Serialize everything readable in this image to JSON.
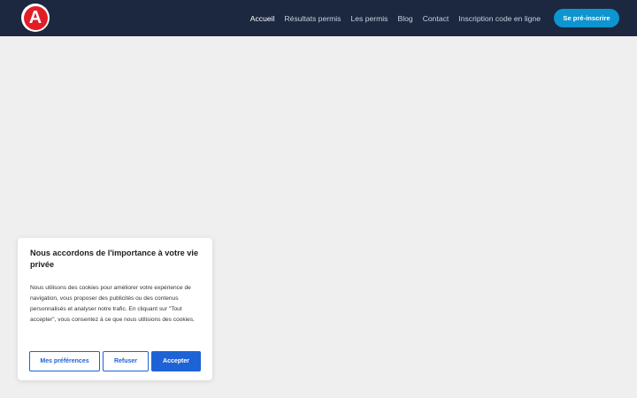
{
  "header": {
    "logo_letter": "A",
    "nav": [
      {
        "label": "Accueil",
        "active": true
      },
      {
        "label": "Résultats permis"
      },
      {
        "label": "Les permis"
      },
      {
        "label": "Blog"
      },
      {
        "label": "Contact"
      },
      {
        "label": "Inscription code en ligne"
      }
    ],
    "cta_label": "Se pré-inscrire"
  },
  "cookie_banner": {
    "title": "Nous accordons de l'importance à votre vie privée",
    "text": "Nous utilisons des cookies pour améliorer votre expérience de navigation, vous proposer des publicités ou des contenus personnalisés et analyser notre trafic. En cliquant sur \"Tout accepter\", vous consentez à ce que nous utilisions des cookies.",
    "preferences_label": "Mes préférences",
    "refuse_label": "Refuser",
    "accept_label": "Accepter"
  },
  "colors": {
    "header_bg": "#1b2840",
    "logo_red": "#e21d26",
    "cta_bg": "#0d95d0",
    "accent_blue": "#1d63d6",
    "page_bg": "#efefef"
  }
}
